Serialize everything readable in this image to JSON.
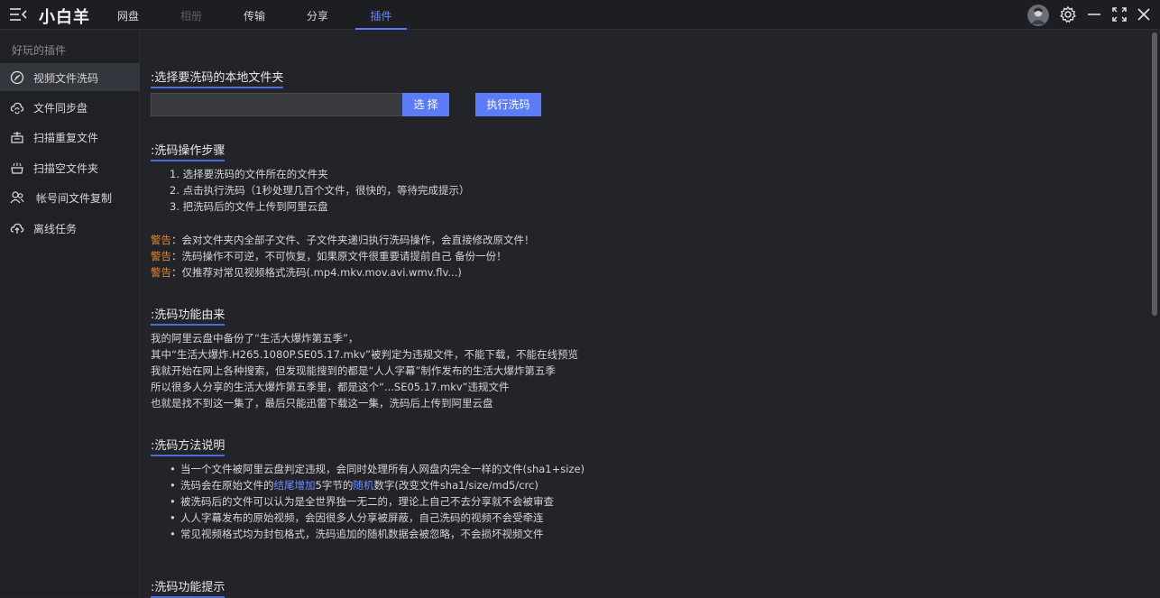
{
  "header": {
    "brand": "小白羊",
    "tabs": [
      {
        "label": "网盘",
        "state": "normal"
      },
      {
        "label": "相册",
        "state": "disabled"
      },
      {
        "label": "传输",
        "state": "normal"
      },
      {
        "label": "分享",
        "state": "normal"
      },
      {
        "label": "插件",
        "state": "active"
      }
    ],
    "icons": [
      "menu-icon",
      "avatar",
      "settings-icon",
      "minimize-icon",
      "maximize-icon",
      "close-icon"
    ]
  },
  "sidebar": {
    "title": "好玩的插件",
    "items": [
      {
        "label": "视频文件洗码",
        "icon": "video-wash-icon",
        "active": true
      },
      {
        "label": "文件同步盘",
        "icon": "cloud-sync-icon",
        "active": false
      },
      {
        "label": "扫描重复文件",
        "icon": "scan-duplicate-icon",
        "active": false
      },
      {
        "label": "扫描空文件夹",
        "icon": "scan-empty-folder-icon",
        "active": false
      },
      {
        "label": "帐号间文件复制",
        "icon": "account-copy-icon",
        "active": false
      },
      {
        "label": "离线任务",
        "icon": "cloud-upload-icon",
        "active": false
      }
    ]
  },
  "main": {
    "select_title": ":选择要洗码的本地文件夹",
    "path_value": "",
    "select_button": "选 择",
    "run_button": "执行洗码",
    "steps_title": ":洗码操作步骤",
    "steps": [
      "1. 选择要洗码的文件所在的文件夹",
      "2. 点击执行洗码（1秒处理几百个文件，很快的，等待完成提示）",
      "3. 把洗码后的文件上传到阿里云盘"
    ],
    "warning_tag": "警告",
    "warnings": [
      "：会对文件夹内全部子文件、子文件夹递归执行洗码操作，会直接修改原文件！",
      "：洗码操作不可逆，不可恢复，如果原文件很重要请提前自己 备份一份！",
      "：仅推荐对常见视频格式洗码(.mp4.mkv.mov.avi.wmv.flv...)"
    ],
    "origin_title": ":洗码功能由来",
    "origin_lines": [
      "我的阿里云盘中备份了“生活大爆炸第五季”，",
      "其中“生活大爆炸.H265.1080P.SE05.17.mkv”被判定为违规文件，不能下载，不能在线预览",
      "我就开始在网上各种搜索，但发现能搜到的都是“人人字幕”制作发布的生活大爆炸第五季",
      "所以很多人分享的生活大爆炸第五季里，都是这个“...SE05.17.mkv”违规文件",
      "也就是找不到这一集了，最后只能迅雷下载这一集，洗码后上传到阿里云盘"
    ],
    "method_title": ":洗码方法说明",
    "method_lines": {
      "b1": "当一个文件被阿里云盘判定违规，会同时处理所有人网盘内完全一样的文件(sha1+size)",
      "b2_pre": "洗码会在原始文件的",
      "b2_link1": "结尾增加",
      "b2_mid": "5字节的",
      "b2_link2": "随机",
      "b2_post": "数字(改变文件sha1/size/md5/crc)",
      "b3": "被洗码后的文件可以认为是全世界独一无二的，理论上自己不去分享就不会被审查",
      "b4": "人人字幕发布的原始视频，会因很多人分享被屏蔽，自己洗码的视频不会受牵连",
      "b5": "常见视频格式均为封包格式，洗码追加的随机数据会被忽略，不会损坏视频文件"
    },
    "tips_title": ":洗码功能提示"
  }
}
